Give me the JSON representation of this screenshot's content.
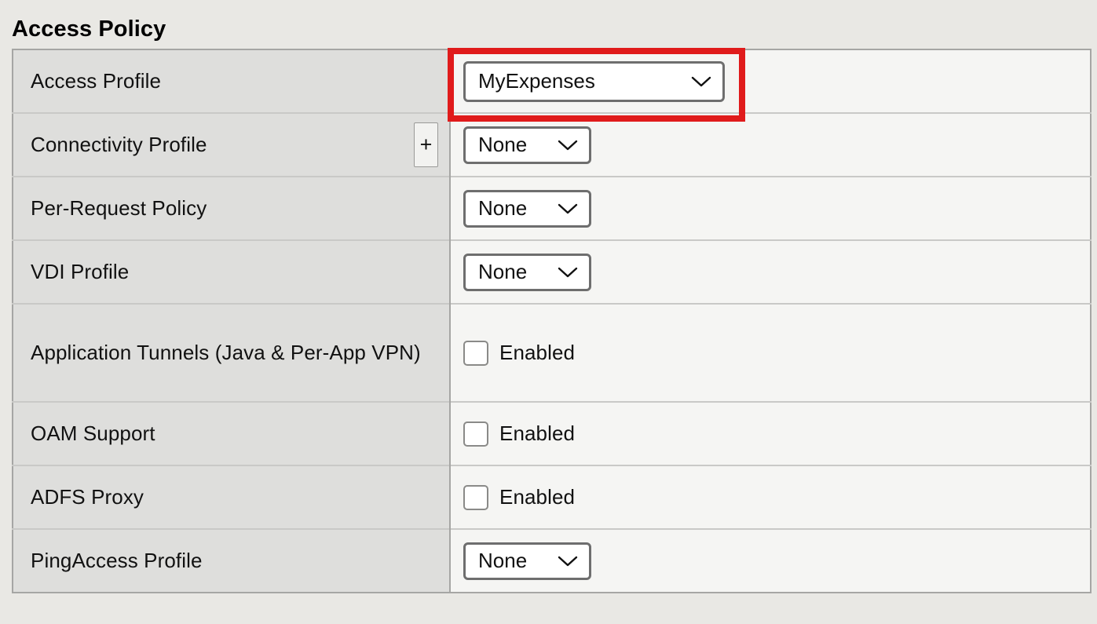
{
  "section": {
    "title": "Access Policy"
  },
  "rows": [
    {
      "label": "Access Profile",
      "control": "select",
      "value": "MyExpenses",
      "has_add_button": false,
      "highlighted": true
    },
    {
      "label": "Connectivity Profile",
      "control": "select",
      "value": "None",
      "has_add_button": true,
      "add_button_label": "+",
      "highlighted": false
    },
    {
      "label": "Per-Request Policy",
      "control": "select",
      "value": "None",
      "has_add_button": false,
      "highlighted": false
    },
    {
      "label": "VDI Profile",
      "control": "select",
      "value": "None",
      "has_add_button": false,
      "highlighted": false
    },
    {
      "label": "Application Tunnels (Java & Per-App VPN)",
      "control": "checkbox",
      "value": "Enabled",
      "checked": false,
      "has_add_button": false,
      "highlighted": false
    },
    {
      "label": "OAM Support",
      "control": "checkbox",
      "value": "Enabled",
      "checked": false,
      "has_add_button": false,
      "highlighted": false
    },
    {
      "label": "ADFS Proxy",
      "control": "checkbox",
      "value": "Enabled",
      "checked": false,
      "has_add_button": false,
      "highlighted": false
    },
    {
      "label": "PingAccess Profile",
      "control": "select",
      "value": "None",
      "has_add_button": false,
      "highlighted": false
    }
  ],
  "icons": {
    "chevron": "chevron-down-icon",
    "add": "plus-icon"
  },
  "colors": {
    "page_background": "#e9e8e4",
    "label_cell_background": "#dededc",
    "value_cell_background": "#f5f5f3",
    "table_border": "#a6a6a4",
    "highlight": "#e01b1b",
    "control_border": "#6e6e6e",
    "text": "#111111"
  }
}
